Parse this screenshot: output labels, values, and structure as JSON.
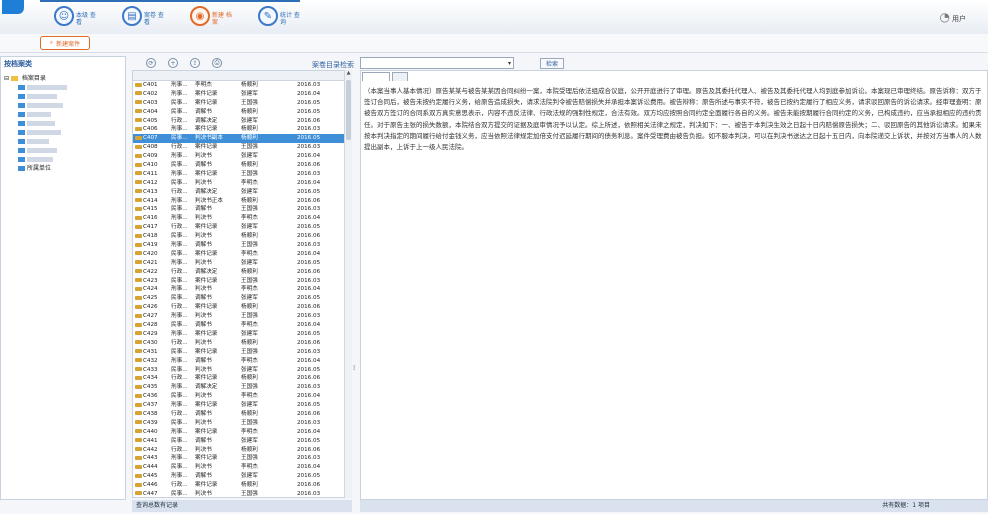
{
  "topbar": {
    "modules": [
      {
        "icon": "person-icon",
        "glyph": "☺",
        "label": "本级 查看"
      },
      {
        "icon": "document-icon",
        "glyph": "▤",
        "label": "案卷 查看"
      },
      {
        "icon": "archive-icon",
        "glyph": "◉",
        "label": "新建 档案"
      },
      {
        "icon": "settings-icon",
        "glyph": "✎",
        "label": "统计 查询"
      }
    ],
    "help_glyph": "◔",
    "user": "用户"
  },
  "subbar": {
    "new_case_label": "新建案件",
    "new_case_glyph": "⌕"
  },
  "left": {
    "title": "按档案类",
    "root_label": "档案目录",
    "nodes": [
      "",
      "",
      "",
      "",
      "",
      "",
      "",
      "",
      "",
      "",
      "所属单位"
    ]
  },
  "toolbar": {
    "icons": [
      {
        "name": "refresh-icon",
        "glyph": "⟳"
      },
      {
        "name": "add-icon",
        "glyph": "+"
      },
      {
        "name": "export-icon",
        "glyph": "⇪"
      },
      {
        "name": "print-icon",
        "glyph": "⎙"
      }
    ],
    "search_label": "案卷目录检索",
    "search_value": "",
    "search_button": "检索"
  },
  "table": {
    "headers": [
      "",
      "",
      "",
      "",
      ""
    ],
    "selected_index": 6,
    "rows": [
      [
        "C401",
        "刑事...",
        "李明杰",
        "杨顺利",
        "2016.03"
      ],
      [
        "C402",
        "刑事...",
        "案件记录",
        "张建军",
        "2016.04"
      ],
      [
        "C403",
        "民事...",
        "案件记录",
        "王国强",
        "2016.05"
      ],
      [
        "C404",
        "民事...",
        "调解书",
        "杨顺利",
        "2016.05"
      ],
      [
        "C405",
        "行政...",
        "调解决定",
        "张建军",
        "2016.06"
      ],
      [
        "C406",
        "刑事...",
        "案件记录",
        "杨顺利",
        "2016.03"
      ],
      [
        "C407",
        "民事...",
        "判决书副本",
        "杨顺利",
        "2016.05"
      ],
      [
        "C408",
        "行政...",
        "案件记录",
        "王国强",
        "2016.03"
      ],
      [
        "C409",
        "刑事...",
        "判决书",
        "张建军",
        "2016.04"
      ],
      [
        "C410",
        "民事...",
        "调解书",
        "杨顺利",
        "2016.06"
      ],
      [
        "C411",
        "刑事...",
        "案件记录",
        "王国强",
        "2016.03"
      ],
      [
        "C412",
        "民事...",
        "判决书",
        "李明杰",
        "2016.04"
      ],
      [
        "C413",
        "行政...",
        "调解决定",
        "张建军",
        "2016.05"
      ],
      [
        "C414",
        "刑事...",
        "判决书正本",
        "杨顺利",
        "2016.06"
      ],
      [
        "C415",
        "民事...",
        "调解书",
        "王国强",
        "2016.03"
      ],
      [
        "C416",
        "刑事...",
        "判决书",
        "李明杰",
        "2016.04"
      ],
      [
        "C417",
        "行政...",
        "案件记录",
        "张建军",
        "2016.05"
      ],
      [
        "C418",
        "民事...",
        "判决书",
        "杨顺利",
        "2016.06"
      ],
      [
        "C419",
        "刑事...",
        "调解书",
        "王国强",
        "2016.03"
      ],
      [
        "C420",
        "民事...",
        "案件记录",
        "李明杰",
        "2016.04"
      ],
      [
        "C421",
        "刑事...",
        "判决书",
        "张建军",
        "2016.05"
      ],
      [
        "C422",
        "行政...",
        "调解决定",
        "杨顺利",
        "2016.06"
      ],
      [
        "C423",
        "民事...",
        "案件记录",
        "王国强",
        "2016.03"
      ],
      [
        "C424",
        "刑事...",
        "判决书",
        "李明杰",
        "2016.04"
      ],
      [
        "C425",
        "民事...",
        "调解书",
        "张建军",
        "2016.05"
      ],
      [
        "C426",
        "行政...",
        "案件记录",
        "杨顺利",
        "2016.06"
      ],
      [
        "C427",
        "刑事...",
        "判决书",
        "王国强",
        "2016.03"
      ],
      [
        "C428",
        "民事...",
        "调解书",
        "李明杰",
        "2016.04"
      ],
      [
        "C429",
        "刑事...",
        "案件记录",
        "张建军",
        "2016.05"
      ],
      [
        "C430",
        "行政...",
        "判决书",
        "杨顺利",
        "2016.06"
      ],
      [
        "C431",
        "民事...",
        "案件记录",
        "王国强",
        "2016.03"
      ],
      [
        "C432",
        "刑事...",
        "调解书",
        "李明杰",
        "2016.04"
      ],
      [
        "C433",
        "民事...",
        "判决书",
        "张建军",
        "2016.05"
      ],
      [
        "C434",
        "行政...",
        "案件记录",
        "杨顺利",
        "2016.06"
      ],
      [
        "C435",
        "刑事...",
        "调解决定",
        "王国强",
        "2016.03"
      ],
      [
        "C436",
        "民事...",
        "判决书",
        "李明杰",
        "2016.04"
      ],
      [
        "C437",
        "刑事...",
        "案件记录",
        "张建军",
        "2016.05"
      ],
      [
        "C438",
        "行政...",
        "调解书",
        "杨顺利",
        "2016.06"
      ],
      [
        "C439",
        "民事...",
        "判决书",
        "王国强",
        "2016.03"
      ],
      [
        "C440",
        "刑事...",
        "案件记录",
        "李明杰",
        "2016.04"
      ],
      [
        "C441",
        "民事...",
        "调解书",
        "张建军",
        "2016.05"
      ],
      [
        "C442",
        "行政...",
        "判决书",
        "杨顺利",
        "2016.06"
      ],
      [
        "C443",
        "刑事...",
        "案件记录",
        "王国强",
        "2016.03"
      ],
      [
        "C444",
        "民事...",
        "判决书",
        "李明杰",
        "2016.04"
      ],
      [
        "C445",
        "刑事...",
        "调解书",
        "张建军",
        "2016.05"
      ],
      [
        "C446",
        "行政...",
        "案件记录",
        "杨顺利",
        "2016.06"
      ],
      [
        "C447",
        "民事...",
        "判决书",
        "王国强",
        "2016.03"
      ]
    ]
  },
  "status": {
    "left": "查询总数有记录",
    "right": "共有数据：1 项目"
  },
  "doc": {
    "tabs": [
      "",
      ""
    ],
    "body": "（本案当事人基本情况）原告某某与被告某某因合同纠纷一案，本院受理后依法组成合议庭，公开开庭进行了审理。原告及其委托代理人、被告及其委托代理人均到庭参加诉讼。本案现已审理终结。原告诉称：双方于签订合同后，被告未按约定履行义务，给原告造成损失，请求法院判令被告赔偿损失并承担本案诉讼费用。被告辩称：原告所述与事实不符，被告已按约定履行了相应义务，请求驳回原告的诉讼请求。经审理查明：原被告双方签订的合同系双方真实意思表示，内容不违反法律、行政法规的强制性规定，合法有效。双方均应按照合同约定全面履行各自的义务。被告未能按期履行合同约定的义务，已构成违约，应当承担相应的违约责任。对于原告主张的损失数额，本院结合双方提交的证据及庭审情况予以认定。综上所述，依照相关法律之规定，判决如下：一、被告于本判决生效之日起十日内赔偿原告损失；二、驳回原告的其他诉讼请求。如果未按本判决指定的期间履行给付金钱义务，应当依照法律规定加倍支付迟延履行期间的债务利息。案件受理费由被告负担。如不服本判决，可以在判决书送达之日起十五日内，向本院递交上诉状，并按对方当事人的人数提出副本，上诉于上一级人民法院。"
  }
}
